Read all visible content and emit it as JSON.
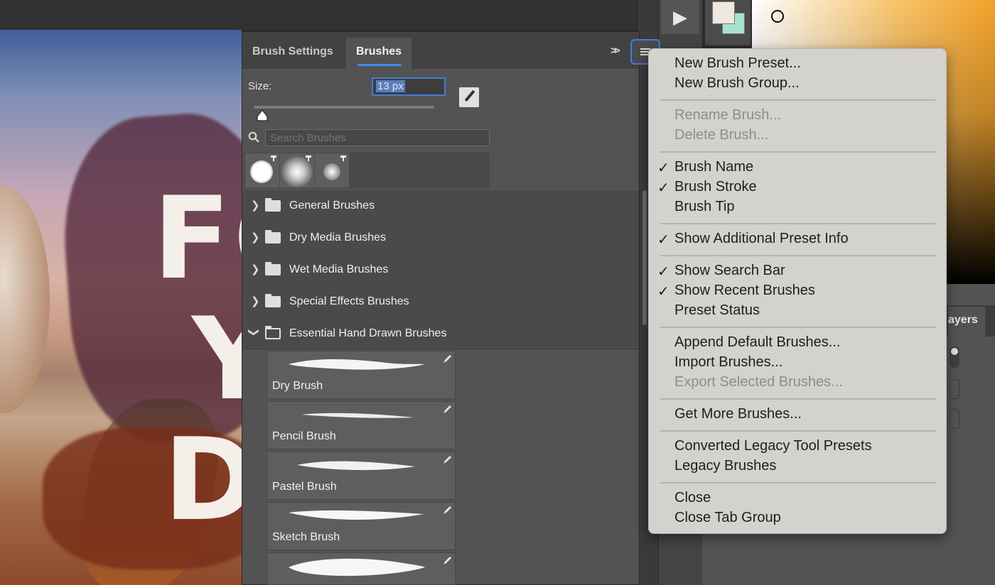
{
  "brushes_panel": {
    "tabs": [
      "Brush Settings",
      "Brushes"
    ],
    "active_tab": "Brushes",
    "size_label": "Size:",
    "size_value": "13 px",
    "search_placeholder": "Search Brushes",
    "groups": [
      {
        "name": "General Brushes",
        "expanded": false
      },
      {
        "name": "Dry Media Brushes",
        "expanded": false
      },
      {
        "name": "Wet Media Brushes",
        "expanded": false
      },
      {
        "name": "Special Effects Brushes",
        "expanded": false
      },
      {
        "name": "Essential Hand Drawn Brushes",
        "expanded": true
      }
    ],
    "brushes": [
      "Dry Brush",
      "Pencil Brush",
      "Pastel Brush",
      "Sketch Brush"
    ]
  },
  "context_menu": {
    "items": [
      {
        "label": "New Brush Preset...",
        "enabled": true,
        "checked": false
      },
      {
        "label": "New Brush Group...",
        "enabled": true,
        "checked": false
      },
      {
        "label": "Rename Brush...",
        "enabled": false,
        "checked": false
      },
      {
        "label": "Delete Brush...",
        "enabled": false,
        "checked": false
      },
      {
        "label": "Brush Name",
        "enabled": true,
        "checked": true
      },
      {
        "label": "Brush Stroke",
        "enabled": true,
        "checked": true
      },
      {
        "label": "Brush Tip",
        "enabled": true,
        "checked": false
      },
      {
        "label": "Show Additional Preset Info",
        "enabled": true,
        "checked": true
      },
      {
        "label": "Show Search Bar",
        "enabled": true,
        "checked": true
      },
      {
        "label": "Show Recent Brushes",
        "enabled": true,
        "checked": true
      },
      {
        "label": "Preset Status",
        "enabled": true,
        "checked": false
      },
      {
        "label": "Append Default Brushes...",
        "enabled": true,
        "checked": false
      },
      {
        "label": "Import Brushes...",
        "enabled": true,
        "checked": false
      },
      {
        "label": "Export Selected Brushes...",
        "enabled": false,
        "checked": false
      },
      {
        "label": "Get More Brushes...",
        "enabled": true,
        "checked": false
      },
      {
        "label": "Converted Legacy Tool Presets",
        "enabled": true,
        "checked": false
      },
      {
        "label": "Legacy Brushes",
        "enabled": true,
        "checked": false
      },
      {
        "label": "Close",
        "enabled": true,
        "checked": false
      },
      {
        "label": "Close Tab Group",
        "enabled": true,
        "checked": false
      }
    ],
    "check_glyph": "✓"
  },
  "layers_panel": {
    "tab_label_partial": "ayers"
  },
  "canvas_text": [
    "FO",
    "Y",
    "D"
  ],
  "colors": {
    "foreground": "#efe8df",
    "background": "#a8e3cc",
    "accent": "#3f8cf0",
    "menu_bg": "#d3d2ce"
  },
  "icons": [
    "play-icon",
    "collapse-panels-icon",
    "panel-menu-icon",
    "brush-tool-icon",
    "search-icon",
    "chevron-right-icon",
    "chevron-down-icon",
    "folder-icon",
    "edit-brush-icon",
    "checkmark-icon"
  ]
}
